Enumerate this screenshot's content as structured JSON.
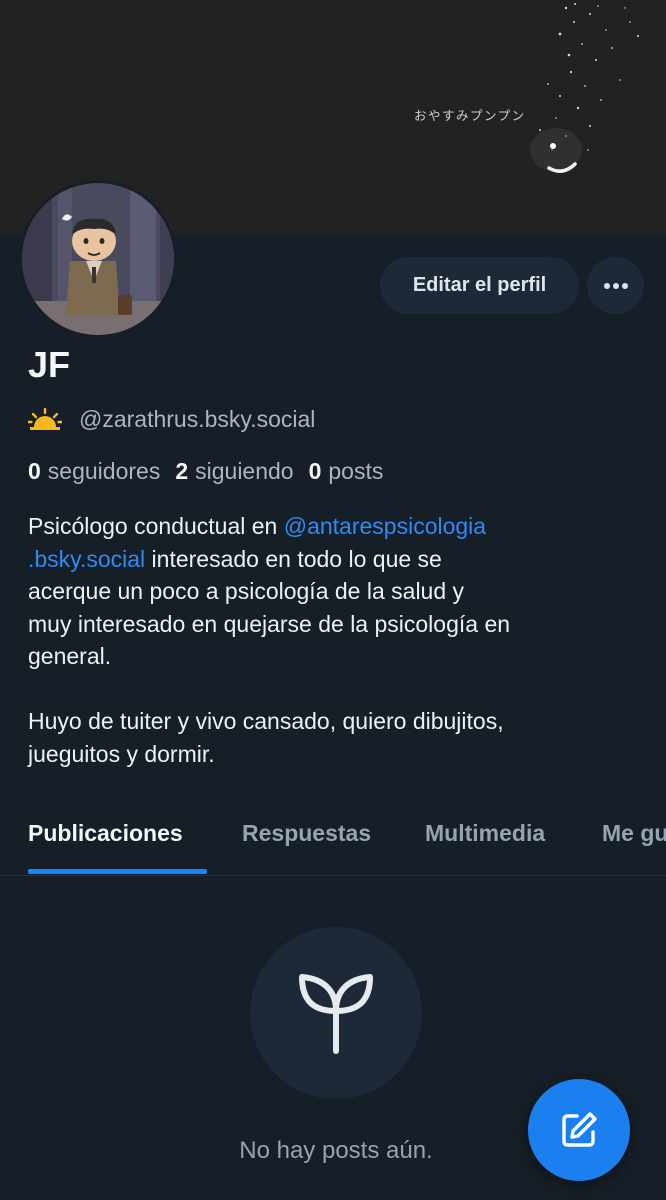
{
  "banner": {
    "caption": "おやすみプンプン"
  },
  "profile": {
    "display_name": "JF",
    "handle": "@zarathrus.bsky.social",
    "handle_icon": "sunrise-icon",
    "followers_count": "0",
    "followers_label": "seguidores",
    "following_count": "2",
    "following_label": "siguiendo",
    "posts_count": "0",
    "posts_label": "posts"
  },
  "actions": {
    "edit_profile": "Editar el perfil",
    "more_icon": "more-horizontal-icon"
  },
  "bio": {
    "line1_text": "Psicólogo conductual en ",
    "line1_mention": "@antarespsicologia",
    "line2_mention": ".bsky.social",
    "line2_text": " interesado en todo lo que se",
    "line3": "acerque un poco a psicología de la salud y",
    "line4": "muy interesado en quejarse de la psicología en",
    "line5": "general.",
    "line6": "Huyo de tuiter y vivo cansado, quiero dibujitos,",
    "line7": "jueguitos y dormir."
  },
  "tabs": [
    {
      "label": "Publicaciones",
      "active": true
    },
    {
      "label": "Respuestas",
      "active": false
    },
    {
      "label": "Multimedia",
      "active": false
    },
    {
      "label": "Me gusta",
      "active": false
    }
  ],
  "empty_state": {
    "icon": "seedling-icon",
    "message": "No hay posts aún."
  },
  "fab": {
    "icon": "compose-icon"
  },
  "colors": {
    "background": "#161e27",
    "accent": "#1a85ff",
    "mention": "#2f8bf3",
    "button_bg": "#1e2937",
    "muted_text": "#aab6c3"
  }
}
